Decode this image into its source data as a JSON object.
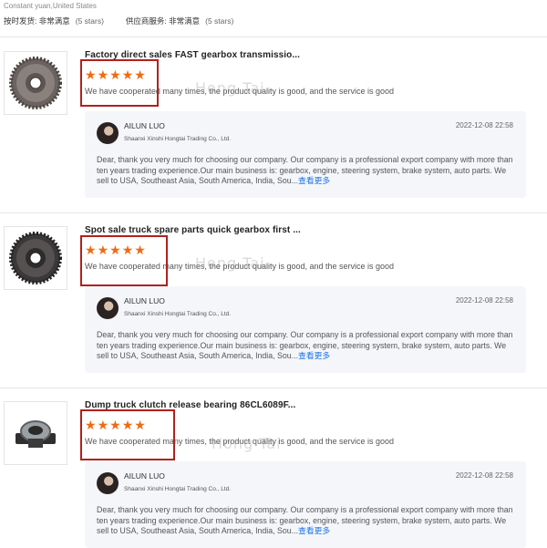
{
  "header": {
    "buyer_location": "Constant yuan,United States",
    "ratings": [
      {
        "label": "按时发货: 非常满意",
        "note": "(5 stars)"
      },
      {
        "label": "供应商服务: 非常满意",
        "note": "(5 stars)"
      }
    ]
  },
  "reviews": [
    {
      "product_title": "Factory direct sales FAST gearbox transmissio...",
      "rating": 5,
      "text": "We have cooperated many times, the product quality is good, and the service is good",
      "watermark": "Hong Tai",
      "reply": {
        "name": "AILUN LUO",
        "company": "Shaanxi Xinshi Hongtai Trading Co., Ltd.",
        "date": "2022-12-08 22:58",
        "body": "Dear, thank you very much for choosing our company. Our company is a professional export company with more than ten years trading experience.Our main business is: gearbox, engine, steering system, brake system, auto parts. We sell to USA, Southeast Asia, South America, India, Sou...",
        "more": "查看更多"
      }
    },
    {
      "product_title": "Spot sale truck spare parts quick gearbox first ...",
      "rating": 5,
      "text": "We have cooperated many times, the product quality is good, and the service is good",
      "watermark": "Hong Tai",
      "reply": {
        "name": "AILUN LUO",
        "company": "Shaanxi Xinshi Hongtai Trading Co., Ltd.",
        "date": "2022-12-08 22:58",
        "body": "Dear, thank you very much for choosing our company. Our company is a professional export company with more than ten years trading experience.Our main business is: gearbox, engine, steering system, brake system, auto parts. We sell to USA, Southeast Asia, South America, India, Sou...",
        "more": "查看更多"
      }
    },
    {
      "product_title": "Dump truck clutch release bearing 86CL6089F...",
      "rating": 5,
      "text": "We have cooperated many times, the product quality is good, and the service is good",
      "watermark": "Hong Tai",
      "reply": {
        "name": "AILUN LUO",
        "company": "Shaanxi Xinshi Hongtai Trading Co., Ltd.",
        "date": "2022-12-08 22:58",
        "body": "Dear, thank you very much for choosing our company. Our company is a professional export company with more than ten years trading experience.Our main business is: gearbox, engine, steering system, brake system, auto parts. We sell to USA, Southeast Asia, South America, India, Sou...",
        "more": "查看更多"
      }
    }
  ],
  "colors": {
    "star": "#f26a10",
    "highlight_box": "#b0211e",
    "link": "#1a73e8"
  },
  "icons": {
    "rating": "star-icon"
  }
}
